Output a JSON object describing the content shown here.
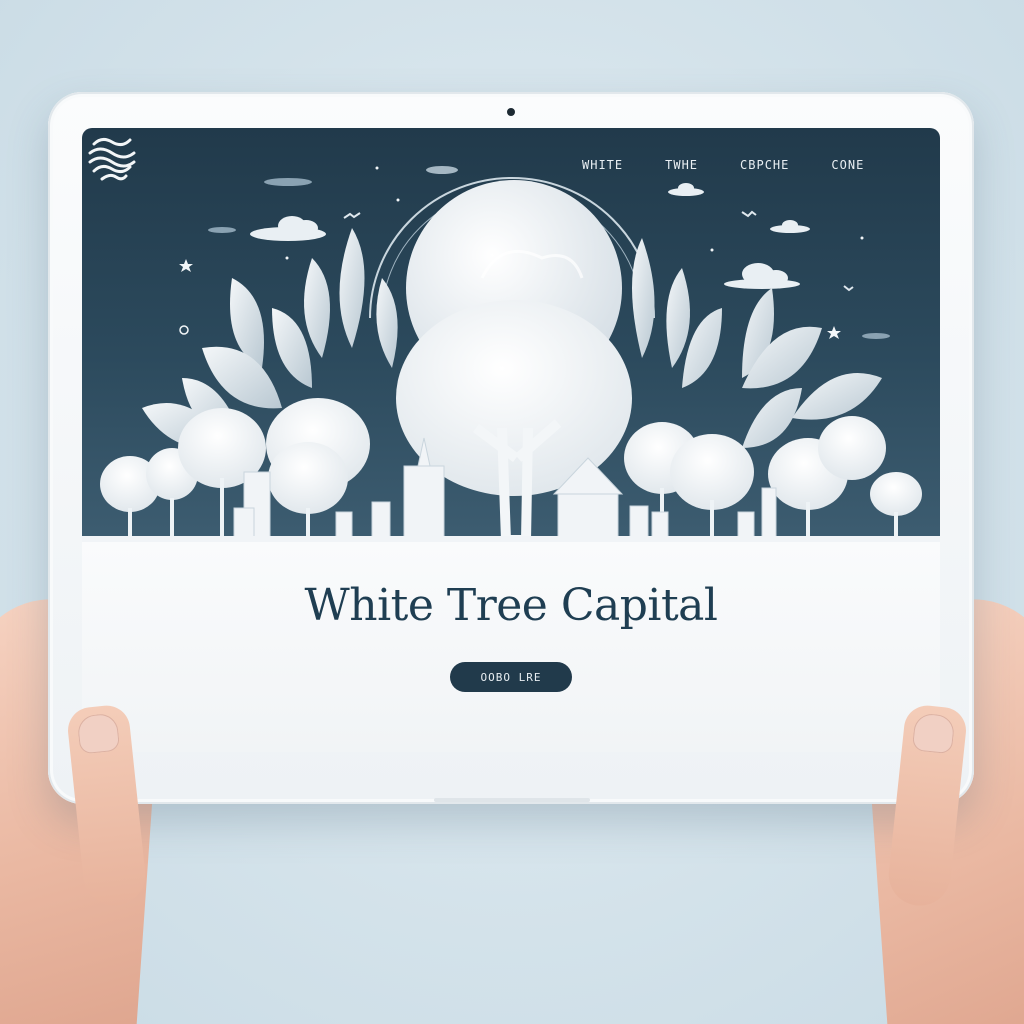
{
  "site": {
    "nav": [
      "WHITE",
      "TWHE",
      "CBPCHE",
      "CONE"
    ],
    "title": "White Tree Capital",
    "cta_label": "OOBO LRE"
  },
  "icons": {
    "logo": "wave-fingerprint-logo-icon",
    "camera": "front-camera-dot-icon"
  },
  "colors": {
    "hero_bg": "#213a4b",
    "title": "#1f3e52",
    "cta_bg": "#213a4b",
    "background": "#d6e4ec"
  }
}
